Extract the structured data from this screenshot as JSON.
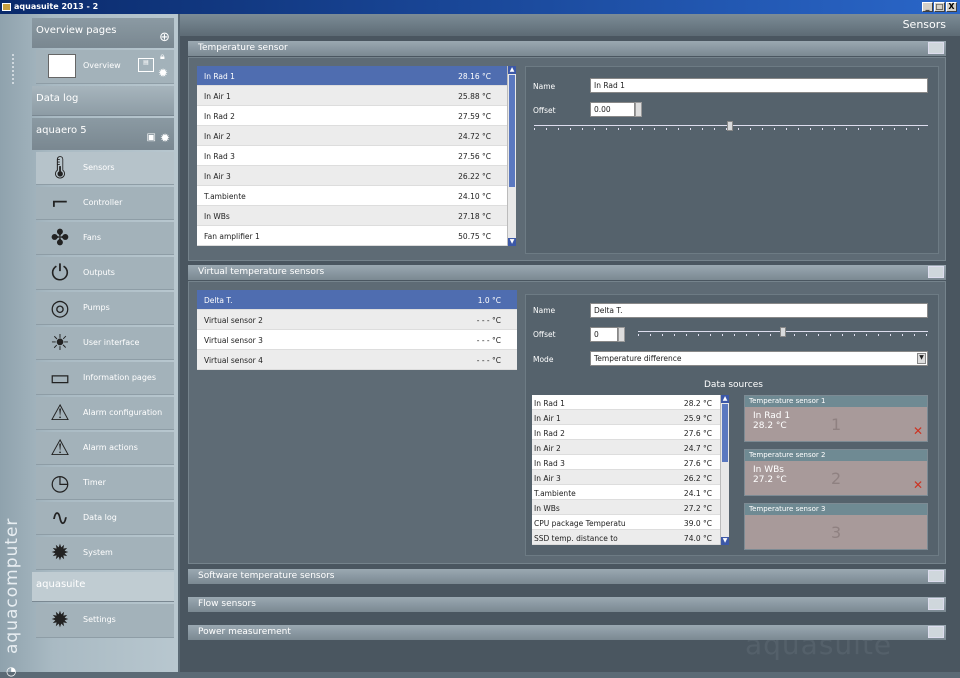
{
  "window": {
    "title": "aquasuite 2013 - 2",
    "buttons": [
      "_",
      "□",
      "X"
    ]
  },
  "brand": "aquacomputer",
  "watermark": "aquasuite",
  "sidebar": {
    "overview_section": "Overview pages",
    "overview_item": "Overview",
    "datalog_section": "Data log",
    "device_section": "aquaero 5",
    "items": [
      {
        "label": "Sensors",
        "icon": "thermometer-icon"
      },
      {
        "label": "Controller",
        "icon": "controller-icon"
      },
      {
        "label": "Fans",
        "icon": "fan-icon"
      },
      {
        "label": "Outputs",
        "icon": "outputs-icon"
      },
      {
        "label": "Pumps",
        "icon": "pump-icon"
      },
      {
        "label": "User interface",
        "icon": "user-interface-icon"
      },
      {
        "label": "Information pages",
        "icon": "information-pages-icon"
      },
      {
        "label": "Alarm configuration",
        "icon": "alarm-icon"
      },
      {
        "label": "Alarm actions",
        "icon": "alarm-actions-icon"
      },
      {
        "label": "Timer",
        "icon": "timer-icon"
      },
      {
        "label": "Data log",
        "icon": "data-log-icon"
      },
      {
        "label": "System",
        "icon": "system-gear-icon"
      }
    ],
    "app_section": "aquasuite",
    "settings_item": "Settings"
  },
  "header": {
    "title": "Sensors"
  },
  "temperature_sensor": {
    "title": "Temperature sensor",
    "rows": [
      {
        "name": "In Rad 1",
        "value": "28.16 °C"
      },
      {
        "name": "In Air 1",
        "value": "25.88 °C"
      },
      {
        "name": "In Rad 2",
        "value": "27.59 °C"
      },
      {
        "name": "In Air 2",
        "value": "24.72 °C"
      },
      {
        "name": "In Rad 3",
        "value": "27.56 °C"
      },
      {
        "name": "In Air 3",
        "value": "26.22 °C"
      },
      {
        "name": "T.ambiente",
        "value": "24.10 °C"
      },
      {
        "name": "In WBs",
        "value": "27.18 °C"
      },
      {
        "name": "Fan amplifier 1",
        "value": "50.75 °C"
      }
    ],
    "name_label": "Name",
    "name_value": "In Rad 1",
    "offset_label": "Offset",
    "offset_value": "0.00",
    "slider_level": 0.49
  },
  "virtual_sensors": {
    "title": "Virtual temperature sensors",
    "rows": [
      {
        "name": "Delta T.",
        "value": "1.0 °C"
      },
      {
        "name": "Virtual sensor 2",
        "value": "- - - °C"
      },
      {
        "name": "Virtual sensor 3",
        "value": "- - - °C"
      },
      {
        "name": "Virtual sensor 4",
        "value": "- - - °C"
      }
    ],
    "name_label": "Name",
    "name_value": "Delta T.",
    "offset_label": "Offset",
    "offset_value": "0",
    "slider_level": 0.49,
    "mode_label": "Mode",
    "mode_value": "Temperature difference",
    "data_sources_title": "Data sources",
    "sources": [
      {
        "name": "In Rad 1",
        "value": "28.2 °C"
      },
      {
        "name": "In Air 1",
        "value": "25.9 °C"
      },
      {
        "name": "In Rad 2",
        "value": "27.6 °C"
      },
      {
        "name": "In Air 2",
        "value": "24.7 °C"
      },
      {
        "name": "In Rad 3",
        "value": "27.6 °C"
      },
      {
        "name": "In Air 3",
        "value": "26.2 °C"
      },
      {
        "name": "T.ambiente",
        "value": "24.1 °C"
      },
      {
        "name": "In WBs",
        "value": "27.2 °C"
      },
      {
        "name": "CPU package Temperatu",
        "value": "39.0 °C"
      },
      {
        "name": "SSD temp. distance to",
        "value": "74.0 °C"
      }
    ],
    "cards": [
      {
        "header": "Temperature sensor 1",
        "name": "In Rad 1",
        "value": "28.2 °C",
        "num": "1"
      },
      {
        "header": "Temperature sensor 2",
        "name": "In WBs",
        "value": "27.2 °C",
        "num": "2"
      },
      {
        "header": "Temperature sensor 3",
        "name": "",
        "value": "",
        "num": "3"
      }
    ]
  },
  "collapsed_panels": [
    "Software temperature sensors",
    "Flow sensors",
    "Power measurement"
  ]
}
